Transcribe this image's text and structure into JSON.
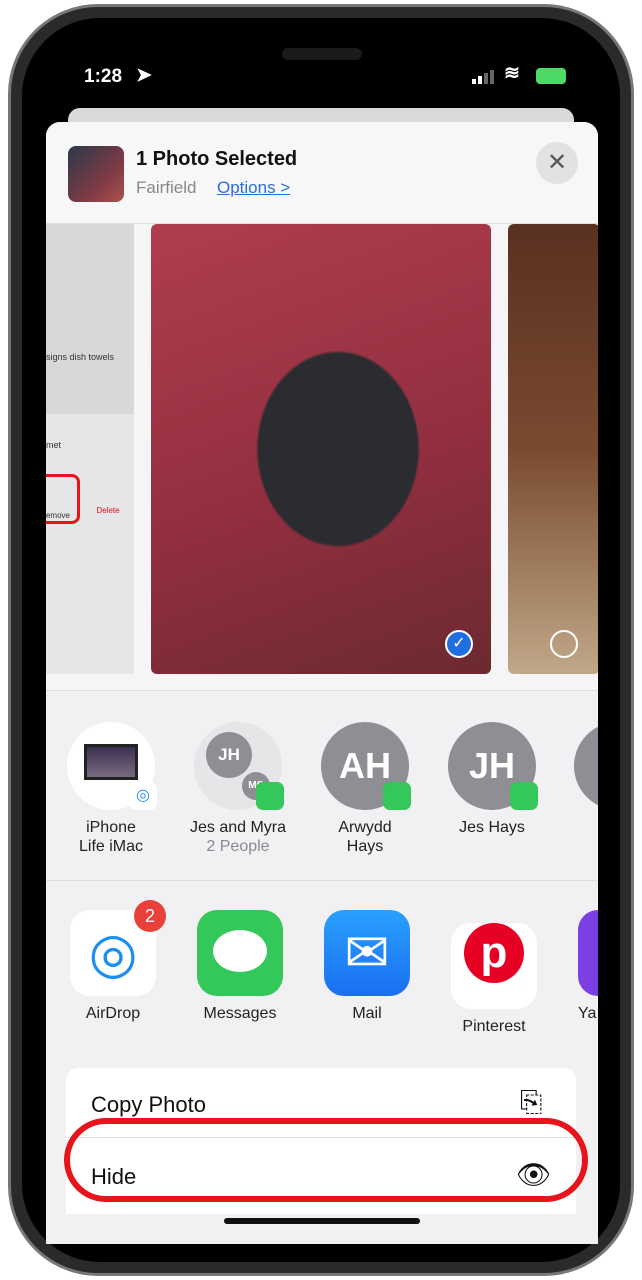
{
  "status_bar": {
    "time": "1:28"
  },
  "header": {
    "title": "1 Photo Selected",
    "location": "Fairfield",
    "options": "Options >",
    "close": "✕"
  },
  "background_screenshot": {
    "text1": "signs dish towels",
    "text2": "met",
    "remove": "emove",
    "delete": "Delete"
  },
  "people": [
    {
      "name": "iPhone\nLife iMac",
      "line1": "iPhone",
      "line2": "Life iMac",
      "badge": "airdrop"
    },
    {
      "line1": "Jes and Myra",
      "line2": "2 People",
      "initials": "JH",
      "initials2": "MC",
      "badge": "messages"
    },
    {
      "line1": "Arwydd",
      "line2": "Hays",
      "initials": "AH",
      "badge": "messages"
    },
    {
      "line1": "Jes Hays",
      "initials": "JH",
      "badge": "messages"
    }
  ],
  "apps": [
    {
      "label": "AirDrop",
      "badge": "2",
      "color": "#1f8ef1"
    },
    {
      "label": "Messages",
      "color": "#34c759"
    },
    {
      "label": "Mail",
      "color": "#1a7cf5"
    },
    {
      "label": "Pinterest",
      "color": "#e60023"
    },
    {
      "label": "Ya",
      "color": "#7b3fe4"
    }
  ],
  "actions": [
    {
      "label": "Copy Photo",
      "icon": "copy-icon"
    },
    {
      "label": "Hide",
      "icon": "eye-slash-icon"
    }
  ],
  "highlight_color": "#e8141b"
}
